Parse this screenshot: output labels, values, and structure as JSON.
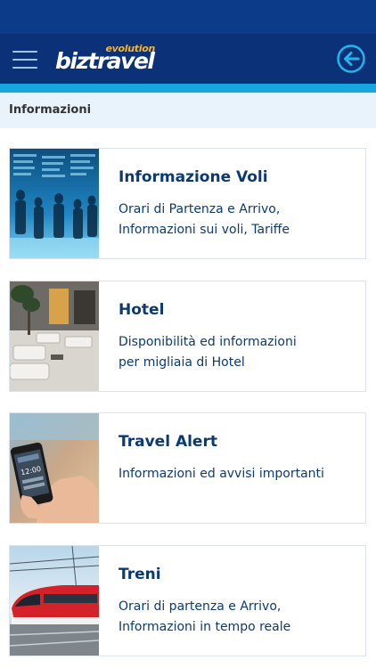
{
  "header": {
    "logo_sub": "evolution",
    "logo_main": "biztravel",
    "menu_icon": "hamburger-menu-icon",
    "back_icon": "back-arrow-circle-icon"
  },
  "colors": {
    "status_bar": "#0c3b8a",
    "header": "#0b3178",
    "accent": "#17a7e0",
    "title_text": "#0b3a73",
    "section_bg": "#e9f3fb"
  },
  "section": {
    "title": "Informazioni"
  },
  "cards": [
    {
      "title": "Informazione Voli",
      "desc_line1": "Orari di Partenza e Arrivo,",
      "desc_line2": "Informazioni sui voli, Tariffe",
      "image": "departure-board-photo"
    },
    {
      "title": "Hotel",
      "desc_line1": "Disponibilità ed informazioni",
      "desc_line2": "per migliaia di Hotel",
      "image": "hotel-lobby-photo"
    },
    {
      "title": "Travel Alert",
      "desc_line1": "Informazioni ed avvisi importanti",
      "desc_line2": "",
      "image": "smartphone-hand-photo"
    },
    {
      "title": "Treni",
      "desc_line1": "Orari di partenza e Arrivo,",
      "desc_line2": "Informazioni in tempo reale",
      "image": "red-train-photo"
    }
  ]
}
